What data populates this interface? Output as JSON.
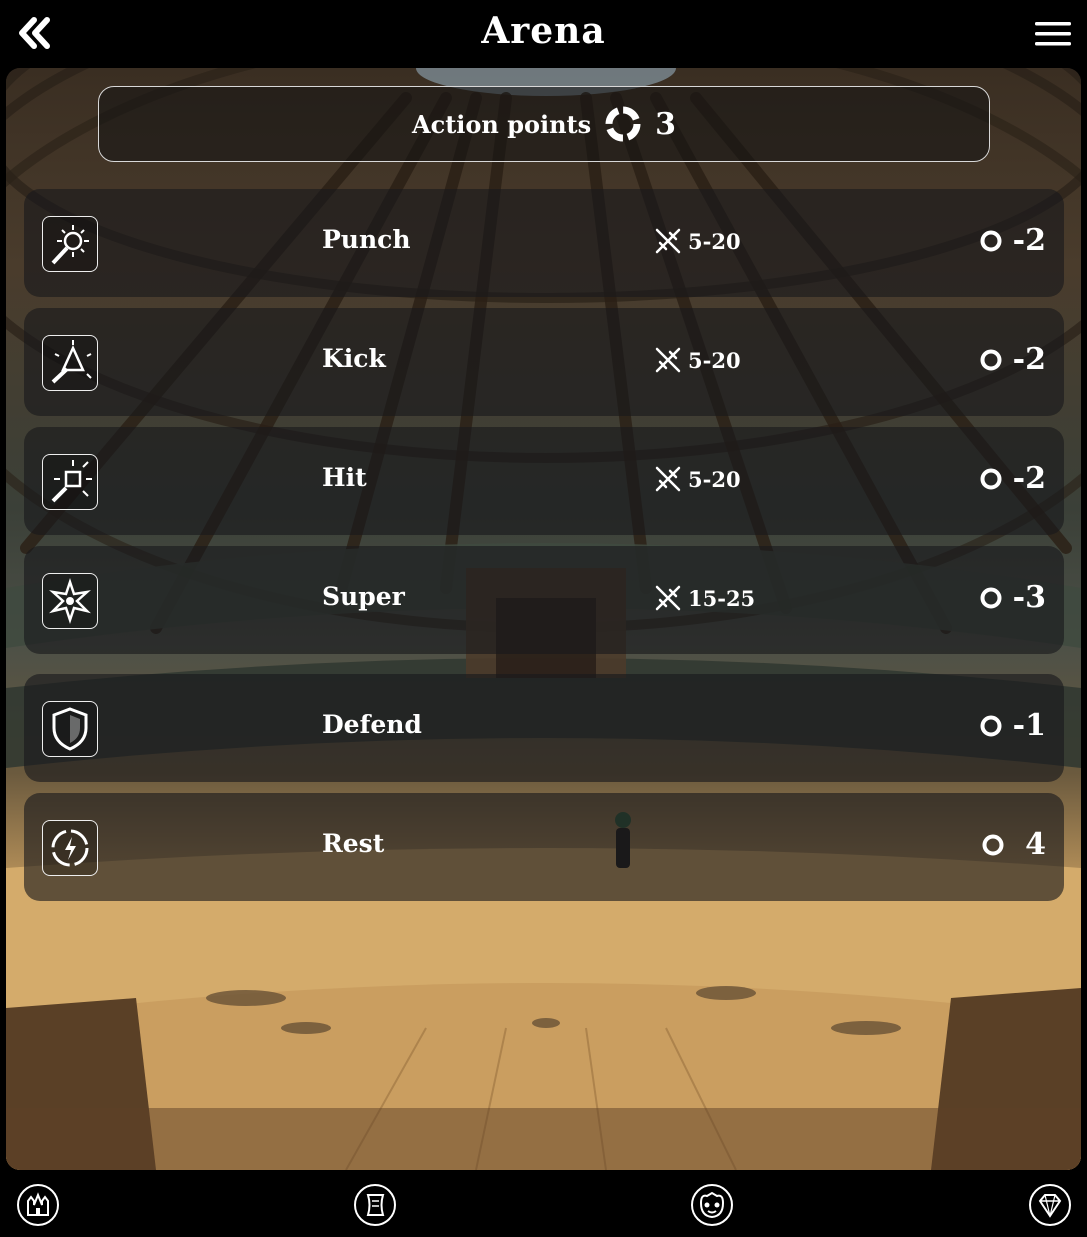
{
  "header": {
    "title": "Arena",
    "back_icon": "double-chevron-left-icon",
    "menu_icon": "hamburger-menu-icon"
  },
  "action_points": {
    "label": "Action points",
    "value": "3",
    "icon": "ring-icon"
  },
  "actions": [
    {
      "name": "Punch",
      "damage": "5-20",
      "cost": "-2",
      "icon": "punch-burst-icon"
    },
    {
      "name": "Kick",
      "damage": "5-20",
      "cost": "-2",
      "icon": "kick-burst-icon"
    },
    {
      "name": "Hit",
      "damage": "5-20",
      "cost": "-2",
      "icon": "hit-burst-icon"
    },
    {
      "name": "Super",
      "damage": "15-25",
      "cost": "-3",
      "icon": "super-burst-icon"
    },
    {
      "name": "Defend",
      "damage": "",
      "cost": "-1",
      "icon": "shield-icon"
    },
    {
      "name": "Rest",
      "damage": "",
      "cost": "4",
      "icon": "rest-cycle-icon"
    }
  ],
  "bottom_nav": [
    {
      "name": "castle",
      "icon": "castle-icon"
    },
    {
      "name": "scroll",
      "icon": "scroll-icon"
    },
    {
      "name": "character",
      "icon": "creature-face-icon"
    },
    {
      "name": "gems",
      "icon": "diamond-icon"
    }
  ],
  "colors": {
    "text": "#ffffff",
    "panel": "#19191c",
    "background": "#000000",
    "sand": "#d2a96a"
  }
}
